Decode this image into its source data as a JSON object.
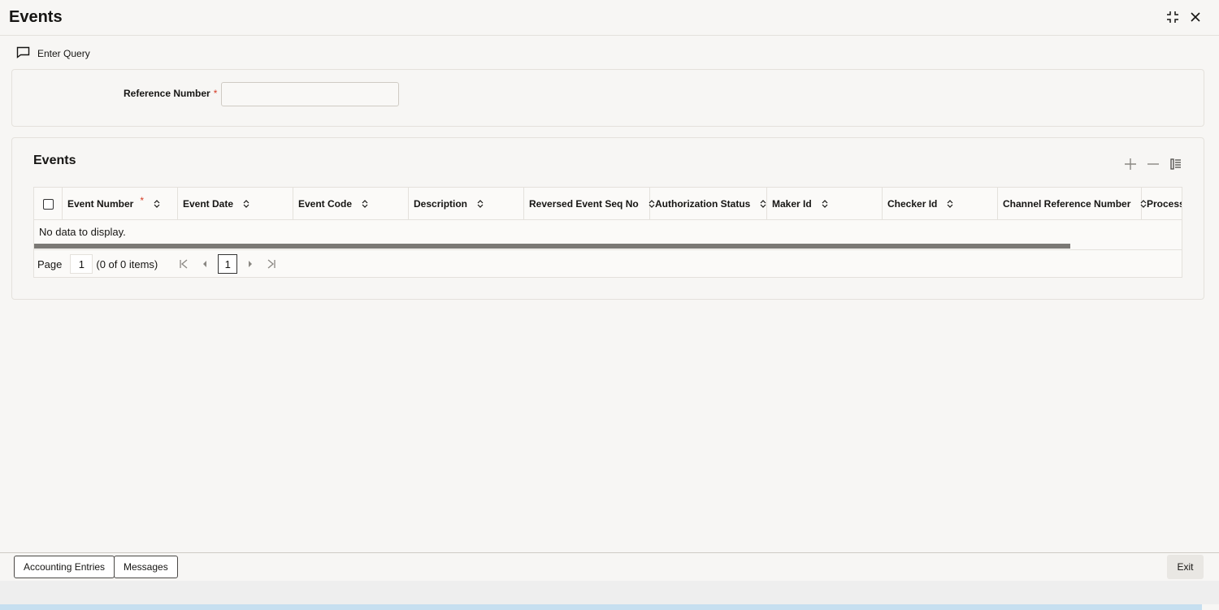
{
  "window": {
    "title": "Events",
    "minimize_icon": "collapse-icon",
    "close_icon": "close-icon"
  },
  "toolbar": {
    "enter_query_label": "Enter Query",
    "enter_query_icon": "message-icon"
  },
  "query_form": {
    "reference_label": "Reference Number",
    "required_marker": "*",
    "reference_value": ""
  },
  "events_section": {
    "title": "Events",
    "actions": [
      "add-icon",
      "remove-icon",
      "columns-icon"
    ],
    "columns": [
      {
        "label": "Event Number",
        "required": "*"
      },
      {
        "label": "Event Date"
      },
      {
        "label": "Event Code"
      },
      {
        "label": "Description"
      },
      {
        "label": "Reversed Event Seq No"
      },
      {
        "label": "Authorization Status"
      },
      {
        "label": "Maker Id"
      },
      {
        "label": "Checker Id"
      },
      {
        "label": "Channel Reference Number"
      },
      {
        "label": "Process R"
      }
    ],
    "empty_message": "No data to display.",
    "pager": {
      "page_label": "Page",
      "page_value": "1",
      "items_text": "(0 of 0 items)",
      "current_page": "1"
    }
  },
  "footer": {
    "accounting_entries_label": "Accounting Entries",
    "messages_label": "Messages",
    "exit_label": "Exit"
  },
  "colors": {
    "required": "#d63b25",
    "status_blue": "#c6dff0"
  }
}
